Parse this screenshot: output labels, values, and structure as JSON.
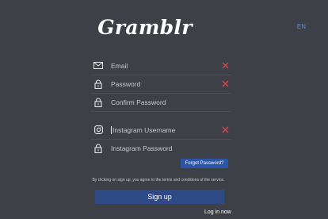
{
  "app": {
    "logo_text": "Gramblr",
    "language": "EN"
  },
  "form": {
    "email": {
      "placeholder": "Email",
      "icon": "envelope-icon",
      "has_clear": true
    },
    "password": {
      "placeholder": "Password",
      "icon": "lock-icon",
      "has_clear": true
    },
    "confirm_password": {
      "placeholder": "Confirm Password",
      "icon": "lock-icon",
      "has_clear": false
    },
    "instagram_username": {
      "placeholder": "Instagram Username",
      "icon": "instagram-icon",
      "has_clear": true
    },
    "instagram_password": {
      "placeholder": "Instagram Password",
      "icon": "lock-icon",
      "has_clear": false
    },
    "forgot_password_label": "Forgot Password?",
    "terms_text": "By clicking on sign up, you agree to the terms and conditions of the service.",
    "signup_label": "Sign up",
    "login_label": "Log in now"
  },
  "colors": {
    "background": "#3d4047",
    "accent_blue": "#2a55a8",
    "button_blue": "#2e4a86",
    "error_red": "#e04545",
    "lang_blue": "#5b8fe0"
  }
}
